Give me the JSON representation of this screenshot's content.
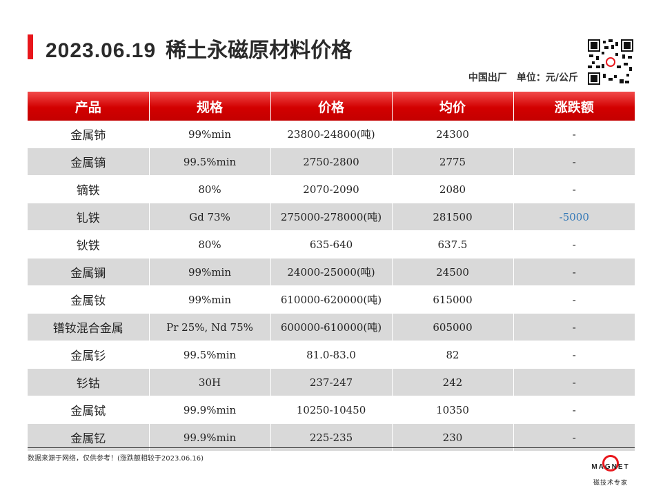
{
  "header": {
    "date": "2023.06.19",
    "title": "稀土永磁原材料价格",
    "origin": "中国出厂",
    "unit": "单位：元/公斤"
  },
  "table": {
    "columns": [
      "产品",
      "规格",
      "价格",
      "均价",
      "涨跌额"
    ],
    "rows": [
      {
        "product": "金属铈",
        "spec": "99%min",
        "price": "23800-24800(吨)",
        "avg": "24300",
        "change": "-"
      },
      {
        "product": "金属镝",
        "spec": "99.5%min",
        "price": "2750-2800",
        "avg": "2775",
        "change": "-"
      },
      {
        "product": "镝铁",
        "spec": "80%",
        "price": "2070-2090",
        "avg": "2080",
        "change": "-"
      },
      {
        "product": "钆铁",
        "spec": "Gd 73%",
        "price": "275000-278000(吨)",
        "avg": "281500",
        "change": "-5000"
      },
      {
        "product": "钬铁",
        "spec": "80%",
        "price": "635-640",
        "avg": "637.5",
        "change": "-"
      },
      {
        "product": "金属镧",
        "spec": "99%min",
        "price": "24000-25000(吨)",
        "avg": "24500",
        "change": "-"
      },
      {
        "product": "金属钕",
        "spec": "99%min",
        "price": "610000-620000(吨)",
        "avg": "615000",
        "change": "-"
      },
      {
        "product": "镨钕混合金属",
        "spec": "Pr 25%, Nd 75%",
        "price": "600000-610000(吨)",
        "avg": "605000",
        "change": "-"
      },
      {
        "product": "金属钐",
        "spec": "99.5%min",
        "price": "81.0-83.0",
        "avg": "82",
        "change": "-"
      },
      {
        "product": "钐钴",
        "spec": "30H",
        "price": "237-247",
        "avg": "242",
        "change": "-"
      },
      {
        "product": "金属铽",
        "spec": "99.9%min",
        "price": "10250-10450",
        "avg": "10350",
        "change": "-"
      },
      {
        "product": "金属钇",
        "spec": "99.9%min",
        "price": "225-235",
        "avg": "230",
        "change": "-"
      }
    ]
  },
  "footer": {
    "note": "数据来源于网络，仅供参考！(涨跌额相较于2023.06.16)",
    "logo_text": "MAGNET",
    "logo_sub": "磁技术专家"
  },
  "colors": {
    "accent": "#e8161b",
    "header_bg": "#d20000",
    "stripe": "#d9d9d9",
    "negative": "#2e75b6"
  },
  "icons": [
    "qr-code-icon",
    "magnet-logo-icon"
  ]
}
